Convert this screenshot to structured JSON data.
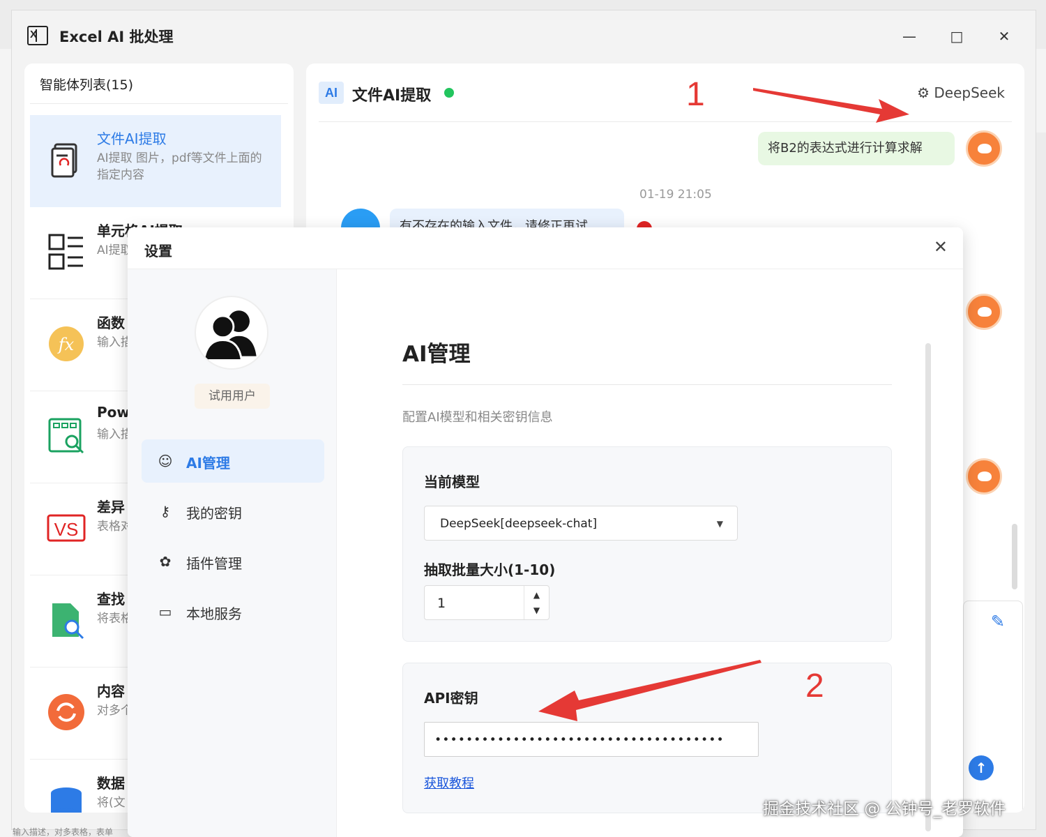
{
  "window": {
    "title": "Excel AI 批处理",
    "minimize": "—",
    "maximize": "□",
    "close": "✕"
  },
  "agents": {
    "header": "智能体列表(15)",
    "items": [
      {
        "name": "文件AI提取",
        "desc": "AI提取 图片，pdf等文件上面的指定内容",
        "icon": "file-extract-icon",
        "color": "#2d7be6"
      },
      {
        "name": "单元格AI提取",
        "desc": "AI提取",
        "icon": "cell-grid-icon",
        "color": "#222222"
      },
      {
        "name": "函数",
        "desc": "输入描述 函数，",
        "icon": "fx-function-icon",
        "color": "#f5b93b"
      },
      {
        "name": "Pow",
        "desc": "输入描述 行数据",
        "icon": "power-query-icon",
        "color": "#1aa260"
      },
      {
        "name": "差异",
        "desc": "表格对比 数据，",
        "icon": "vs-compare-icon",
        "color": "#e02424"
      },
      {
        "name": "查找",
        "desc": "将表格 找，提",
        "icon": "find-file-icon",
        "color": "#1aa260"
      },
      {
        "name": "内容",
        "desc": "对多个 行内容",
        "icon": "refresh-icon",
        "color": "#f26b3a"
      },
      {
        "name": "数据",
        "desc": "将(文",
        "icon": "database-icon",
        "color": "#2d7be6"
      }
    ]
  },
  "chat": {
    "badge": "AI",
    "title": "文件AI提取",
    "model": "DeepSeek",
    "user_message": "将B2的表达式进行计算求解",
    "timestamp": "01-19 21:05",
    "bot_message": "有不存在的输入文件，请修正再试",
    "send_glyph": "↑"
  },
  "annotations": {
    "one": "1",
    "two": "2"
  },
  "settings": {
    "title": "设置",
    "close": "✕",
    "user_role": "试用用户",
    "nav": [
      {
        "label": "AI管理",
        "icon": "robot-icon",
        "glyph": "☺",
        "active": true
      },
      {
        "label": "我的密钥",
        "icon": "key-icon",
        "glyph": "⚷",
        "active": false
      },
      {
        "label": "插件管理",
        "icon": "puzzle-icon",
        "glyph": "✿",
        "active": false
      },
      {
        "label": "本地服务",
        "icon": "monitor-icon",
        "glyph": "▭",
        "active": false
      }
    ],
    "section_title": "AI管理",
    "section_desc": "配置AI模型和相关密钥信息",
    "current_model_label": "当前模型",
    "current_model_value": "DeepSeek[deepseek-chat]",
    "batch_label": "抽取批量大小(1-10)",
    "batch_value": "1",
    "api_key_label": "API密钥",
    "api_key_masked": "•••••••••••••••••••••••••••••••••••••",
    "tutorial_link": "获取教程"
  },
  "watermark": "掘金技术社区 @ 公钟号_老罗软件",
  "bottom_text": "输入描述，对多表格，表单",
  "colors": {
    "accent": "#2d7be6",
    "success": "#22c55e",
    "error": "#e02424",
    "annotation": "#e53935"
  }
}
